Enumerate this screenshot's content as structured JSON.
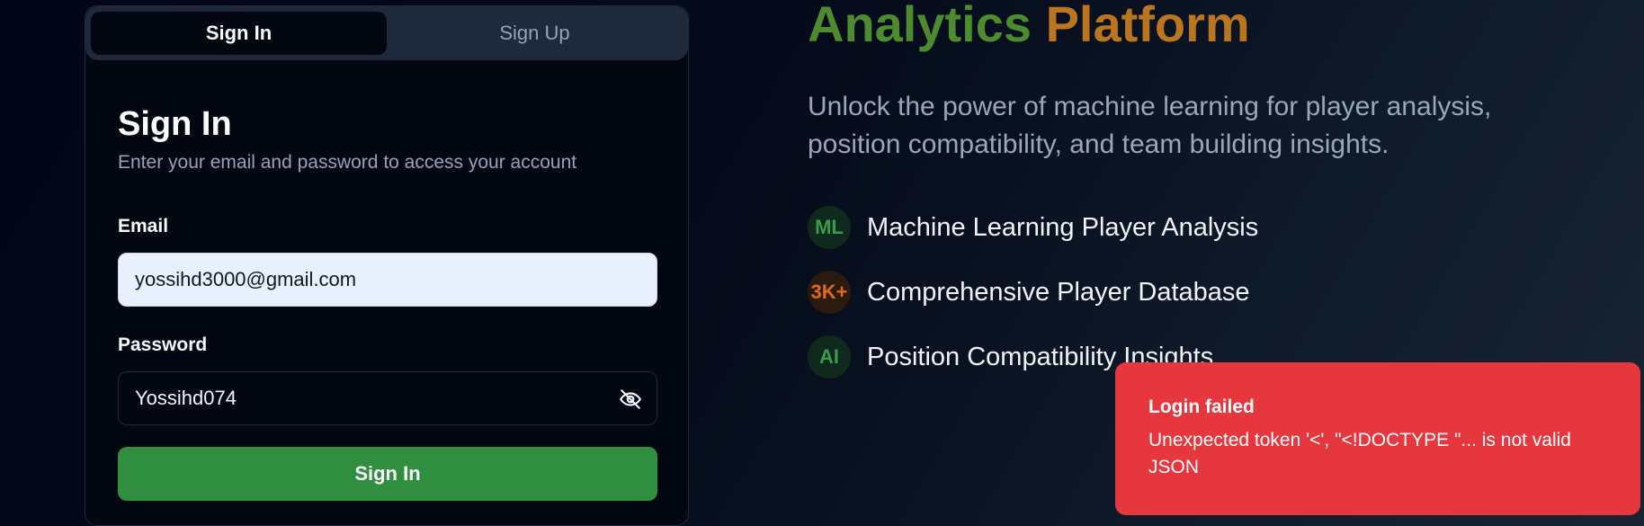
{
  "tabs": [
    {
      "label": "Sign In",
      "active": true
    },
    {
      "label": "Sign Up",
      "active": false
    }
  ],
  "card": {
    "title": "Sign In",
    "subtitle": "Enter your email and password to access your account",
    "email_label": "Email",
    "email_value": "yossihd3000@gmail.com",
    "password_label": "Password",
    "password_value": "Yossihd074",
    "password_toggle_icon": "eye-off-icon",
    "submit_label": "Sign In"
  },
  "hero": {
    "title_part1": "Analytics",
    "title_part2": "Platform",
    "description": "Unlock the power of machine learning for player analysis, position compatibility, and team building insights.",
    "features": [
      {
        "badge": "ML",
        "text": "Machine Learning Player Analysis",
        "color": "#3b9b4c"
      },
      {
        "badge": "3K+",
        "text": "Comprehensive Player Database",
        "color": "#e06a16"
      },
      {
        "badge": "AI",
        "text": "Position Compatibility Insights",
        "color": "#3b9b4c"
      }
    ]
  },
  "toast": {
    "title": "Login failed",
    "message": "Unexpected token '<', \"<!DOCTYPE \"... is not valid JSON",
    "color": "#e5373d"
  },
  "colors": {
    "accent_green": "#2f8f3f",
    "title_green": "#4d8c2e",
    "title_orange": "#b9761e",
    "background": "#020617"
  }
}
